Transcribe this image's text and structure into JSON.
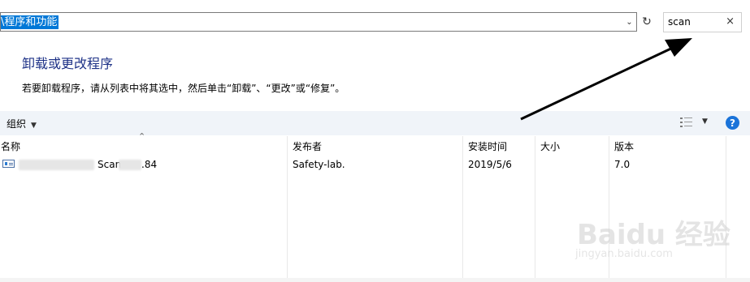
{
  "address_bar": {
    "path": "\\程序和功能"
  },
  "search": {
    "value": "scan",
    "clear_icon": "×"
  },
  "page": {
    "title": "卸载或更改程序",
    "description": "若要卸载程序，请从列表中将其选中，然后单击“卸载”、“更改”或“修复”。"
  },
  "toolbar": {
    "organize_label": "组织",
    "help_glyph": "?"
  },
  "columns": {
    "name": "名称",
    "publisher": "发布者",
    "install_date": "安装时间",
    "size": "大小",
    "version": "版本"
  },
  "programs": [
    {
      "name_fragment_1": "Scan",
      "name_fragment_2": ".84",
      "publisher": "Safety-lab.",
      "install_date": "2019/5/6",
      "size": "",
      "version": "7.0"
    }
  ],
  "watermark": {
    "brand": "Baidu 经验",
    "url": "jingyan.baidu.com"
  },
  "icons": [
    "dropdown-icon",
    "refresh-icon",
    "close-icon",
    "view-options-icon",
    "help-icon",
    "program-icon"
  ],
  "colors": {
    "selection": "#0078d7",
    "title": "#1e3287",
    "toolbar": "#f0f4f9",
    "help": "#1a73d9"
  }
}
